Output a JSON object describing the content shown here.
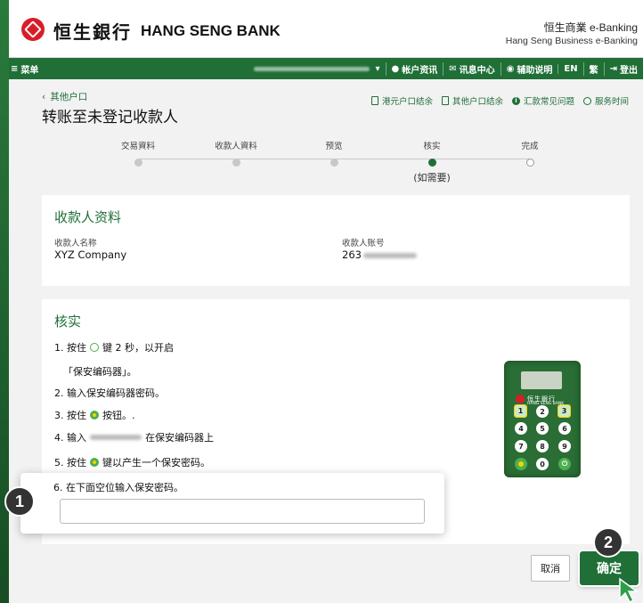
{
  "header": {
    "logo_chinese": "恒生銀行",
    "logo_english": "HANG SENG BANK",
    "product_line1": "恒生商業 e-Banking",
    "product_line2": "Hang Seng Business e-Banking"
  },
  "navbar": {
    "menu_label": "菜单",
    "items": [
      "帐户资讯",
      "讯息中心",
      "辅助说明",
      "EN",
      "繁",
      "登出"
    ]
  },
  "page": {
    "back_label": "其他户口",
    "title": "转账至未登记收款人",
    "quick_links": [
      "港元户口结余",
      "其他户口结余",
      "汇款常见问题",
      "服务时间"
    ]
  },
  "stepper": {
    "steps": [
      "交易資料",
      "收款人資料",
      "预览",
      "核实",
      "完成"
    ],
    "current_index": 3,
    "current_sub": "(如需要)"
  },
  "payee": {
    "title": "收款人资料",
    "name_label": "收款人名称",
    "name_value": "XYZ Company",
    "account_label": "收款人账号",
    "account_prefix": "263"
  },
  "verify": {
    "title": "核实",
    "step1_a": "1. 按住",
    "step1_b": "键 2 秒，以开启",
    "step1_c": "「保安编码器」。",
    "step2": "2. 输入保安编码器密码。",
    "step3_a": "3. 按住",
    "step3_b": "按钮。.",
    "step4_a": "4. 输入",
    "step4_b": "在保安编码器上",
    "step5_a": "5. 按住",
    "step5_b": "键以产生一个保安密码。",
    "step6": "6. 在下面空位输入保安密码。",
    "input_value": ""
  },
  "device": {
    "brand_cn": "恒生銀行",
    "brand_en": "HANG SENG BANK",
    "keys": [
      "1",
      "2",
      "3",
      "4",
      "5",
      "6",
      "7",
      "8",
      "9",
      "0"
    ]
  },
  "actions": {
    "cancel_label": "取消",
    "confirm_label": "确定"
  },
  "annotations": {
    "badge1": "1",
    "badge2": "2"
  },
  "colors": {
    "brand_green": "#1f6f37",
    "brand_red": "#d71e28"
  }
}
